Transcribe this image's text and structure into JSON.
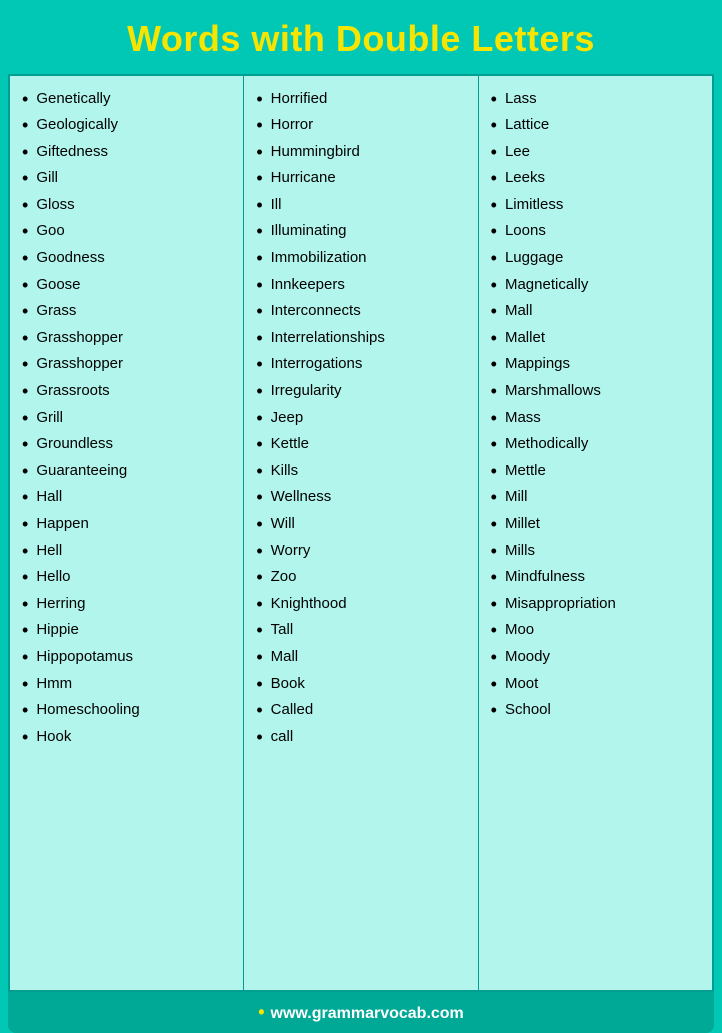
{
  "header": {
    "title": "Words with Double Letters"
  },
  "columns": [
    {
      "words": [
        "Genetically",
        "Geologically",
        "Giftedness",
        "Gill",
        "Gloss",
        "Goo",
        "Goodness",
        "Goose",
        "Grass",
        "Grasshopper",
        "Grasshopper",
        "Grassroots",
        "Grill",
        "Groundless",
        "Guaranteeing",
        "Hall",
        "Happen",
        "Hell",
        "Hello",
        "Herring",
        "Hippie",
        "Hippopotamus",
        "Hmm",
        "Homeschooling",
        "Hook"
      ]
    },
    {
      "words": [
        "Horrified",
        "Horror",
        "Hummingbird",
        "Hurricane",
        "Ill",
        "Illuminating",
        "Immobilization",
        "Innkeepers",
        "Interconnects",
        "Interrelationships",
        "Interrogations",
        "Irregularity",
        "Jeep",
        "Kettle",
        "Kills",
        "Wellness",
        "Will",
        "Worry",
        "Zoo",
        "Knighthood",
        "Tall",
        "Mall",
        "Book",
        "Called",
        "call"
      ]
    },
    {
      "words": [
        "Lass",
        "Lattice",
        "Lee",
        "Leeks",
        "Limitless",
        "Loons",
        "Luggage",
        "Magnetically",
        "Mall",
        "Mallet",
        "Mappings",
        "Marshmallows",
        "Mass",
        "Methodically",
        "Mettle",
        "Mill",
        "Millet",
        "Mills",
        "Mindfulness",
        "Misappropriation",
        "Moo",
        "Moody",
        "Moot",
        "School"
      ]
    }
  ],
  "footer": {
    "bullet": "•",
    "url": "www.grammarvocab.com"
  }
}
